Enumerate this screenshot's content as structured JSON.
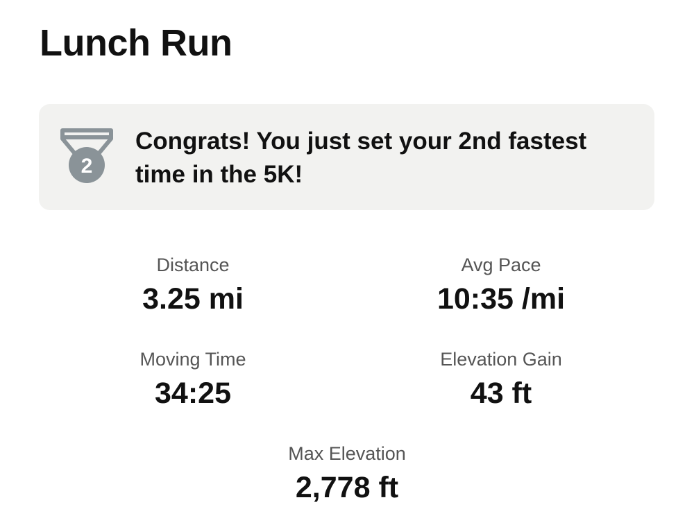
{
  "activity": {
    "title": "Lunch Run"
  },
  "achievement": {
    "icon": "medal-icon",
    "rank": "2",
    "message": "Congrats! You just set your 2nd fastest time in the 5K!",
    "background": "#f2f2f0",
    "icon_color": "#8a9398"
  },
  "stats": {
    "distance": {
      "label": "Distance",
      "value": "3.25 mi"
    },
    "avg_pace": {
      "label": "Avg Pace",
      "value": "10:35 /mi"
    },
    "moving_time": {
      "label": "Moving Time",
      "value": "34:25"
    },
    "elevation_gain": {
      "label": "Elevation Gain",
      "value": "43 ft"
    },
    "max_elevation": {
      "label": "Max Elevation",
      "value": "2,778 ft"
    }
  }
}
